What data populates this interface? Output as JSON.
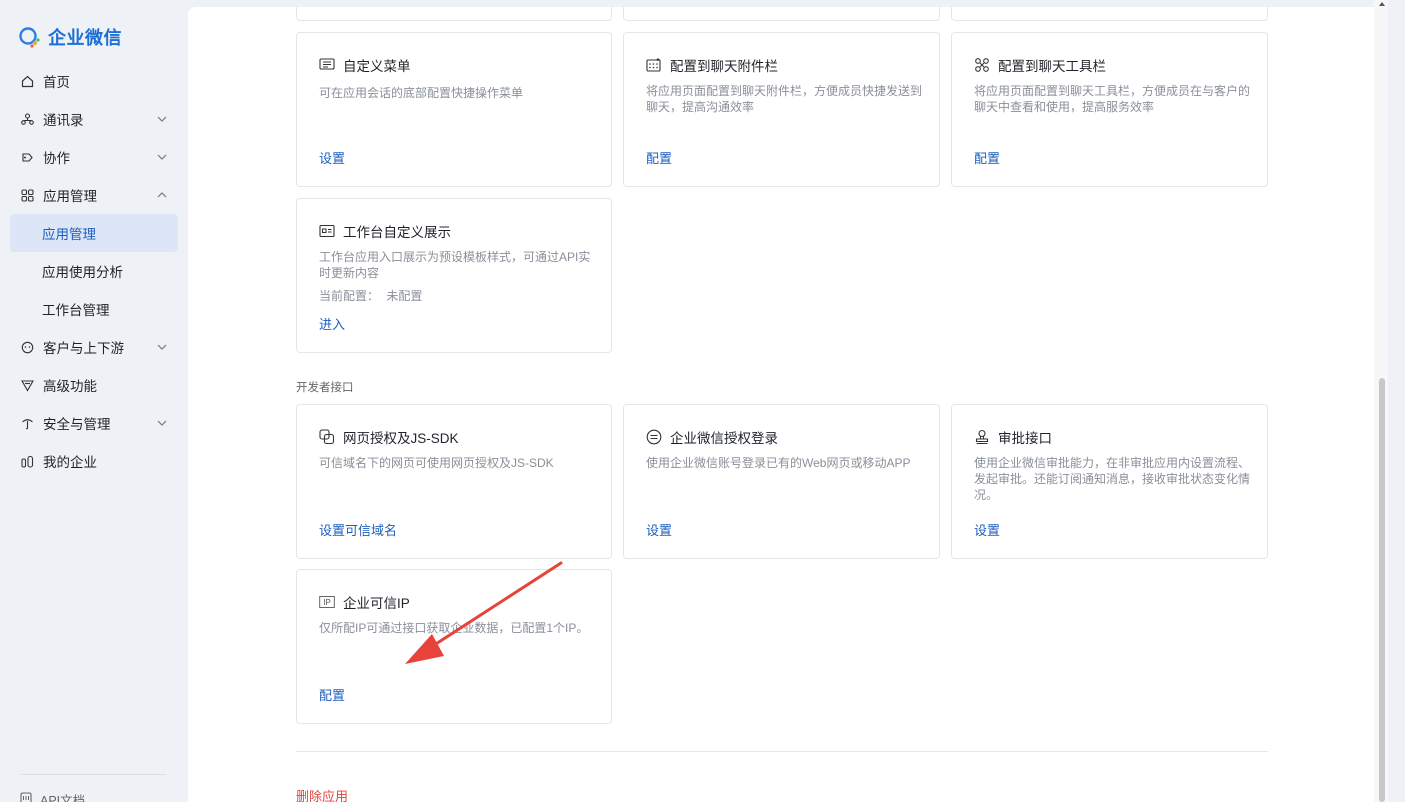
{
  "app": {
    "logo_text": "企业微信"
  },
  "sidebar": {
    "items": [
      {
        "label": "首页",
        "icon": "home-icon",
        "expandable": false
      },
      {
        "label": "通讯录",
        "icon": "contacts-icon",
        "expandable": true
      },
      {
        "label": "协作",
        "icon": "collab-icon",
        "expandable": true
      },
      {
        "label": "应用管理",
        "icon": "apps-icon",
        "expandable": true,
        "expanded": true
      },
      {
        "label": "客户与上下游",
        "icon": "customer-icon",
        "expandable": true
      },
      {
        "label": "高级功能",
        "icon": "advanced-icon",
        "expandable": false
      },
      {
        "label": "安全与管理",
        "icon": "security-icon",
        "expandable": true
      },
      {
        "label": "我的企业",
        "icon": "enterprise-icon",
        "expandable": false
      }
    ],
    "sub_items": [
      "应用管理",
      "应用使用分析",
      "工作台管理"
    ],
    "active_sub": "应用管理",
    "api_doc": "API文档"
  },
  "cards": {
    "custom_menu": {
      "title": "自定义菜单",
      "desc": "可在应用会话的底部配置快捷操作菜单",
      "link": "设置"
    },
    "chat_attach": {
      "title": "配置到聊天附件栏",
      "desc": "将应用页面配置到聊天附件栏，方便成员快捷发送到聊天，提高沟通效率",
      "link": "配置"
    },
    "chat_toolbar": {
      "title": "配置到聊天工具栏",
      "desc": "将应用页面配置到聊天工具栏，方便成员在与客户的聊天中查看和使用，提高服务效率",
      "link": "配置"
    },
    "workbench": {
      "title": "工作台自定义展示",
      "desc": "工作台应用入口展示为预设模板样式，可通过API实时更新内容",
      "current_label": "当前配置：",
      "current_value": "未配置",
      "link": "进入"
    },
    "web_auth": {
      "title": "网页授权及JS-SDK",
      "desc": "可信域名下的网页可使用网页授权及JS-SDK",
      "link": "设置可信域名"
    },
    "wx_login": {
      "title": "企业微信授权登录",
      "desc": "使用企业微信账号登录已有的Web网页或移动APP",
      "link": "设置"
    },
    "approval": {
      "title": "审批接口",
      "desc": "使用企业微信审批能力，在非审批应用内设置流程、发起审批。还能订阅通知消息，接收审批状态变化情况。",
      "link": "设置"
    },
    "trusted_ip": {
      "title": "企业可信IP",
      "desc": "仅所配IP可通过接口获取企业数据，已配置1个IP。",
      "link": "配置",
      "icon_text": "IP"
    }
  },
  "sections": {
    "developer_api": "开发者接口"
  },
  "footer": {
    "delete": "删除应用"
  },
  "colors": {
    "accent": "#1d5fbf",
    "danger": "#e0443c",
    "annotation": "#e8433b"
  }
}
